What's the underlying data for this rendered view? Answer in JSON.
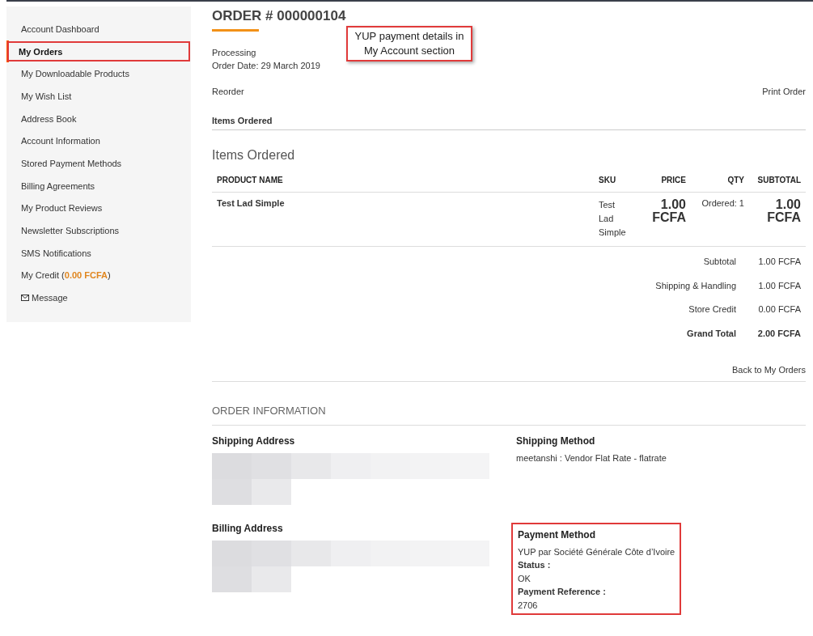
{
  "sidebar": {
    "items": [
      {
        "label": "Account Dashboard",
        "selected": false,
        "highlighted": false,
        "kind": "link"
      },
      {
        "label": "My Orders",
        "selected": true,
        "highlighted": true,
        "kind": "link"
      },
      {
        "label": "My Downloadable Products",
        "selected": false,
        "highlighted": false,
        "kind": "link"
      },
      {
        "label": "My Wish List",
        "selected": false,
        "highlighted": false,
        "kind": "link"
      },
      {
        "label": "Address Book",
        "selected": false,
        "highlighted": false,
        "kind": "link"
      },
      {
        "label": "Account Information",
        "selected": false,
        "highlighted": false,
        "kind": "link"
      },
      {
        "label": "Stored Payment Methods",
        "selected": false,
        "highlighted": false,
        "kind": "link"
      },
      {
        "label": "Billing Agreements",
        "selected": false,
        "highlighted": false,
        "kind": "link"
      },
      {
        "label": "My Product Reviews",
        "selected": false,
        "highlighted": false,
        "kind": "link"
      },
      {
        "label": "Newsletter Subscriptions",
        "selected": false,
        "highlighted": false,
        "kind": "link"
      },
      {
        "label": "SMS Notifications",
        "selected": false,
        "highlighted": false,
        "kind": "link"
      },
      {
        "label": "My Credit (**0.00 FCFA**)",
        "selected": false,
        "highlighted": false,
        "kind": "link"
      },
      {
        "label": "Message",
        "selected": false,
        "highlighted": false,
        "kind": "message"
      }
    ]
  },
  "order": {
    "title": "ORDER # 000000104",
    "status": "Processing",
    "date": "Order Date: 29 March 2019",
    "reorder": "Reorder",
    "print": "Print Order",
    "tab": "Items Ordered"
  },
  "callout": "YUP payment details in My Account section",
  "items": {
    "title": "Items Ordered",
    "columns": [
      "PRODUCT NAME",
      "SKU",
      "PRICE",
      "QTY",
      "SUBTOTAL"
    ],
    "rows": [
      {
        "name": "Test Lad Simple",
        "sku": "Test Lad Simple",
        "price": "1.00 FCFA",
        "qty": "Ordered: 1",
        "subtotal": "1.00 FCFA"
      }
    ],
    "totals": [
      {
        "label": "Subtotal",
        "value": "1.00 FCFA",
        "kind": "normal"
      },
      {
        "label": "Shipping & Handling",
        "value": "1.00 FCFA",
        "kind": "normal"
      },
      {
        "label": "Store Credit",
        "value": "0.00 FCFA",
        "kind": "normal"
      },
      {
        "label": "Grand Total",
        "value": "2.00 FCFA",
        "kind": "grand"
      }
    ],
    "back": "Back to My Orders"
  },
  "info": {
    "title": "ORDER INFORMATION",
    "shipping_address": "Shipping Address",
    "shipping_method": "Shipping Method",
    "shipping_method_value": "meetanshi : Vendor Flat Rate - flatrate",
    "billing_address": "Billing Address",
    "payment": {
      "title": "Payment Method",
      "highlighted": true,
      "lines": [
        {
          "text": "YUP par Société Générale Côte d’Ivoire",
          "kind": "value"
        },
        {
          "text": "Status :",
          "kind": "label"
        },
        {
          "text": "OK",
          "kind": "value"
        },
        {
          "text": "Payment Reference :",
          "kind": "label"
        },
        {
          "text": "2706",
          "kind": "value"
        }
      ]
    }
  }
}
